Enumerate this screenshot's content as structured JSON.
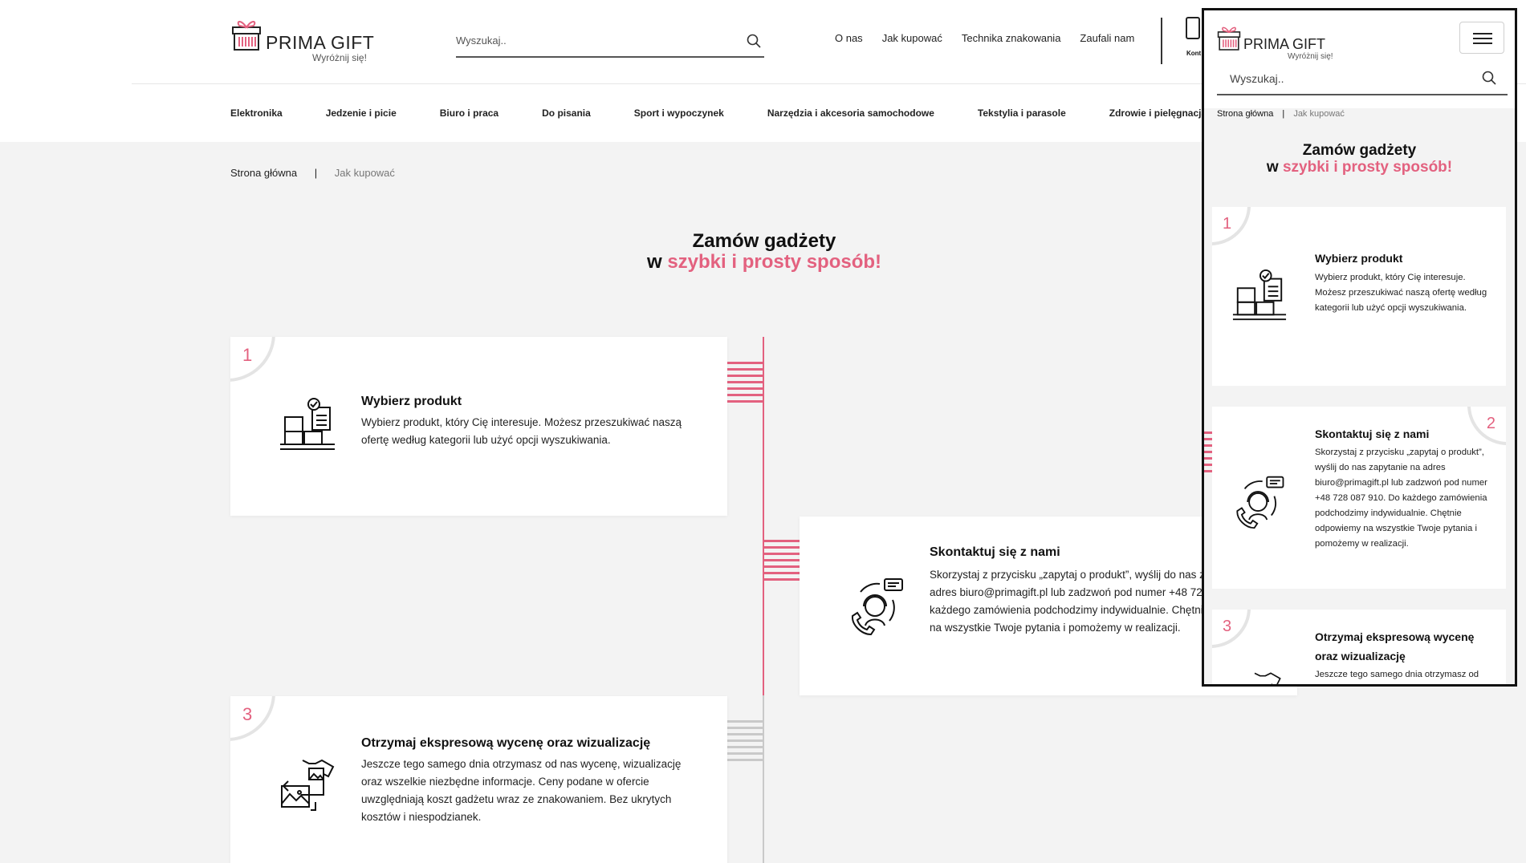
{
  "brand": {
    "name": "PRIMA GIFT",
    "tagline": "Wyróżnij się!"
  },
  "search": {
    "placeholder": "Wyszukaj.."
  },
  "topnav": [
    {
      "label": "O nas"
    },
    {
      "label": "Jak kupować"
    },
    {
      "label": "Technika znakowania"
    },
    {
      "label": "Zaufali nam"
    }
  ],
  "contact_label": "Kont",
  "categories": [
    {
      "label": "Elektronika"
    },
    {
      "label": "Jedzenie i picie"
    },
    {
      "label": "Biuro i praca"
    },
    {
      "label": "Do pisania"
    },
    {
      "label": "Sport i wypoczynek"
    },
    {
      "label": "Narzędzia i akcesoria samochodowe"
    },
    {
      "label": "Tekstylia i parasole"
    },
    {
      "label": "Zdrowie i pielęgnacja"
    }
  ],
  "breadcrumb": {
    "home": "Strona główna",
    "separator": "|",
    "current": "Jak kupować"
  },
  "heading": {
    "line1": "Zamów gadżety",
    "prefix": "w",
    "highlight": "szybki i prosty sposób!"
  },
  "steps": [
    {
      "number": "1",
      "icon": "boxes-checklist-icon",
      "title": "Wybierz produkt",
      "description": "Wybierz produkt, który Cię interesuje. Możesz przeszukiwać naszą ofertę według kategorii lub użyć opcji wyszukiwania."
    },
    {
      "number": "2",
      "icon": "support-agent-icon",
      "title": "Skontaktuj się z nami",
      "description": "Skorzystaj z przycisku „zapytaj o produkt”, wyślij do nas zapytanie na adres biuro@primagift.pl lub zadzwoń pod numer +48 728 087 910. Do każdego zamówienia podchodzimy indywidualnie. Chętnie odpowiemy na wszystkie Twoje pytania i pomożemy w realizacji."
    },
    {
      "number": "3",
      "icon": "tshirt-image-icon",
      "title": "Otrzymaj ekspresową wycenę oraz wizualizację",
      "description": "Jeszcze tego samego dnia otrzymasz od nas wycenę, wizualizację oraz wszelkie niezbędne informacje. Ceny podane w ofercie uwzględniają koszt gadżetu wraz ze znakowaniem. Bez ukrytych kosztów i niespodzianek."
    }
  ],
  "mobile": {
    "step2_description": "Skorzystaj z przycisku „zapytaj o produkt”, wyślij do nas zapytanie na adres biuro@primagift.pl lub zadzwoń pod numer +48 728 087 910. Do każdego zamówienia podchodzimy indywidualnie. Chętnie odpowiemy na wszystkie Twoje pytania i pomożemy w realizacji."
  },
  "colors": {
    "accent": "#e3617f",
    "background": "#f3f3f3",
    "card": "#ffffff"
  }
}
